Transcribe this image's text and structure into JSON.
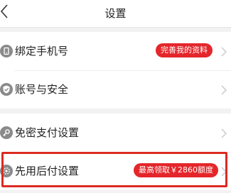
{
  "navbar": {
    "title": "设置",
    "back_icon": "chevron-left-icon"
  },
  "settings": {
    "group1": [
      {
        "label": "绑定手机号",
        "icon": "phone-icon",
        "badge": "完善我的资料"
      },
      {
        "label": "账号与安全",
        "icon": "shield-check-icon"
      }
    ],
    "group2": [
      {
        "label": "免密支付设置",
        "icon": "key-icon"
      },
      {
        "label": "先用后付设置",
        "icon": "gear-badge-icon",
        "badge": "最高领取￥2860额度"
      }
    ]
  },
  "colors": {
    "accent": "#e4262b",
    "highlight_border": "#dd2a22",
    "background": "#f2f2f2",
    "text": "#222222",
    "icon_gray": "#8a8a8a",
    "chevron_gray": "#c8c8c8"
  }
}
